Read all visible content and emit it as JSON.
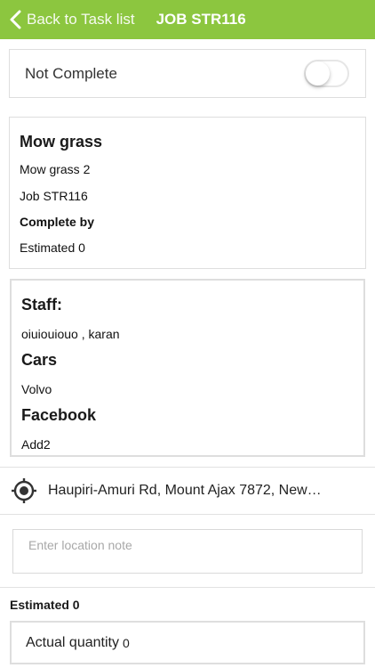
{
  "nav": {
    "back_label": "Back to Task list",
    "title": "JOB STR116",
    "bar_color": "#8cc63f"
  },
  "status": {
    "label": "Not Complete",
    "toggle_on": false
  },
  "task": {
    "title": "Mow grass",
    "subtitle": "Mow grass 2",
    "job": "Job STR116",
    "complete_by_label": "Complete by",
    "estimated": "Estimated 0"
  },
  "details": {
    "staff_heading": "Staff:",
    "staff_value": "oiuiouiouo , karan",
    "cars_heading": "Cars",
    "cars_value": "Volvo",
    "facebook_heading": "Facebook",
    "facebook_value": "Add2"
  },
  "location": {
    "icon": "target-icon",
    "address": "Haupiri-Amuri Rd, Mount Ajax 7872, New…",
    "note_placeholder": "Enter location note",
    "note_value": ""
  },
  "footer": {
    "estimated": "Estimated 0",
    "actual_label": "Actual quantity",
    "actual_value": "0"
  }
}
